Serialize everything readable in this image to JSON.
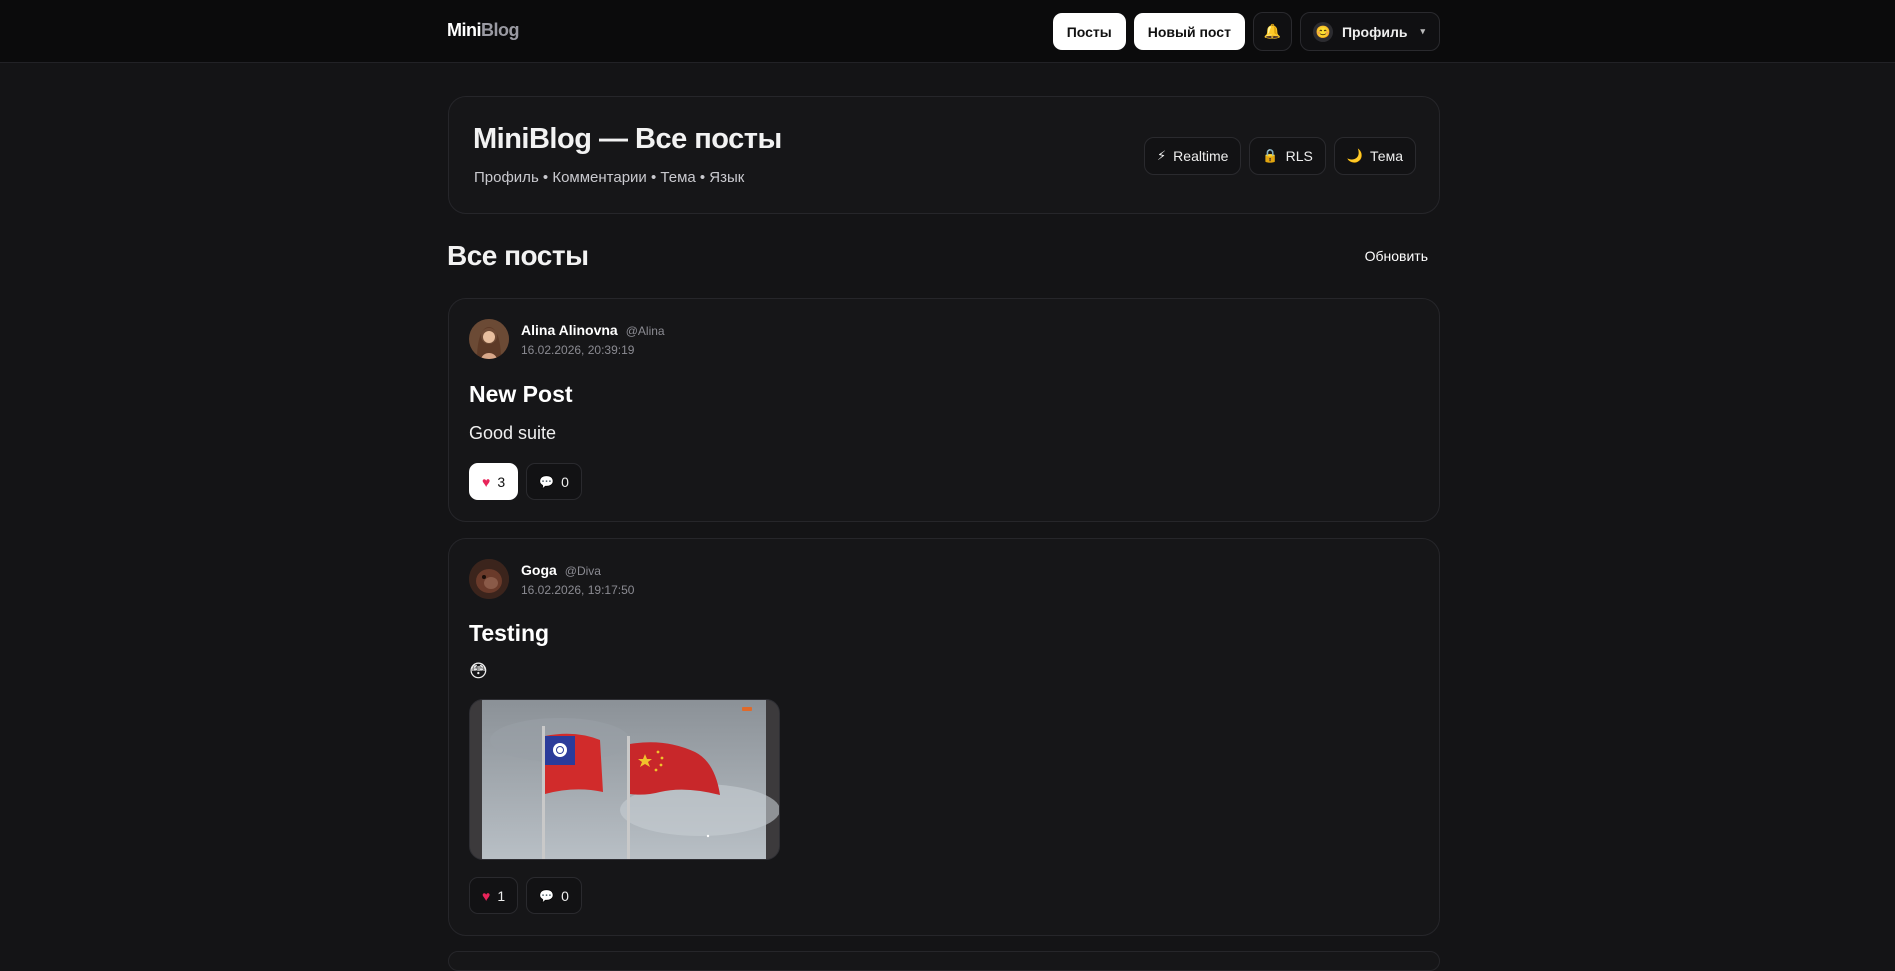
{
  "header": {
    "logo_part1": "Mini",
    "logo_part2": "Blog",
    "nav_posts": "Посты",
    "nav_new_post": "Новый пост",
    "bell_icon": "🔔",
    "profile_avatar": "😊",
    "profile_label": "Профиль",
    "profile_caret": "▾"
  },
  "hero": {
    "title": "MiniBlog — Все посты",
    "subtitle": "Профиль • Комментарии • Тема • Язык",
    "tags": [
      {
        "icon": "⚡",
        "label": "Realtime"
      },
      {
        "icon": "🔒",
        "label": "RLS"
      },
      {
        "icon": "🌙",
        "label": "Тема"
      }
    ]
  },
  "section": {
    "title": "Все посты",
    "refresh_label": "Обновить"
  },
  "posts": [
    {
      "author_name": "Alina Alinovna",
      "author_handle": "@Alina",
      "date": "16.02.2026, 20:39:19",
      "title": "New Post",
      "body": "Good suite",
      "likes": "3",
      "comments": "0",
      "liked": true
    },
    {
      "author_name": "Goga",
      "author_handle": "@Diva",
      "date": "16.02.2026, 19:17:50",
      "title": "Testing",
      "body": "😳",
      "likes": "1",
      "comments": "0",
      "liked": false
    }
  ],
  "icons": {
    "heart": "♥",
    "comment": "💬"
  },
  "colors": {
    "background": "#141416",
    "card": "#161618",
    "heart": "#e8245a"
  }
}
